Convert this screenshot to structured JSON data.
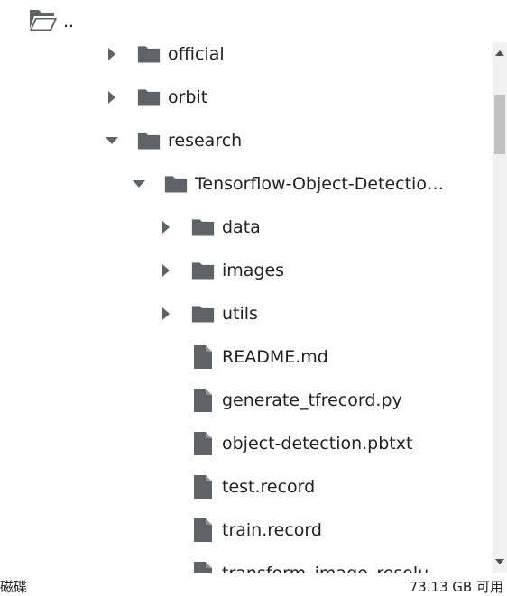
{
  "parent": {
    "label": ".."
  },
  "tree": [
    {
      "name": "official",
      "type": "folder",
      "expanded": false,
      "depth": 0
    },
    {
      "name": "orbit",
      "type": "folder",
      "expanded": false,
      "depth": 0
    },
    {
      "name": "research",
      "type": "folder",
      "expanded": true,
      "depth": 0
    },
    {
      "name": "Tensorflow-Object-Detection-...",
      "type": "folder",
      "expanded": true,
      "depth": 1
    },
    {
      "name": "data",
      "type": "folder",
      "expanded": false,
      "depth": 2
    },
    {
      "name": "images",
      "type": "folder",
      "expanded": false,
      "depth": 2
    },
    {
      "name": "utils",
      "type": "folder",
      "expanded": false,
      "depth": 2
    },
    {
      "name": "README.md",
      "type": "file",
      "depth": 2
    },
    {
      "name": "generate_tfrecord.py",
      "type": "file",
      "depth": 2
    },
    {
      "name": "object-detection.pbtxt",
      "type": "file",
      "depth": 2
    },
    {
      "name": "test.record",
      "type": "file",
      "depth": 2
    },
    {
      "name": "train.record",
      "type": "file",
      "depth": 2
    },
    {
      "name": "transform_image_resolu",
      "type": "file",
      "depth": 2
    }
  ],
  "footer": {
    "disk_label": "磁碟",
    "disk_free": "73.13 GB 可用"
  },
  "colors": {
    "icon": "#5f6368",
    "text": "#202124"
  }
}
